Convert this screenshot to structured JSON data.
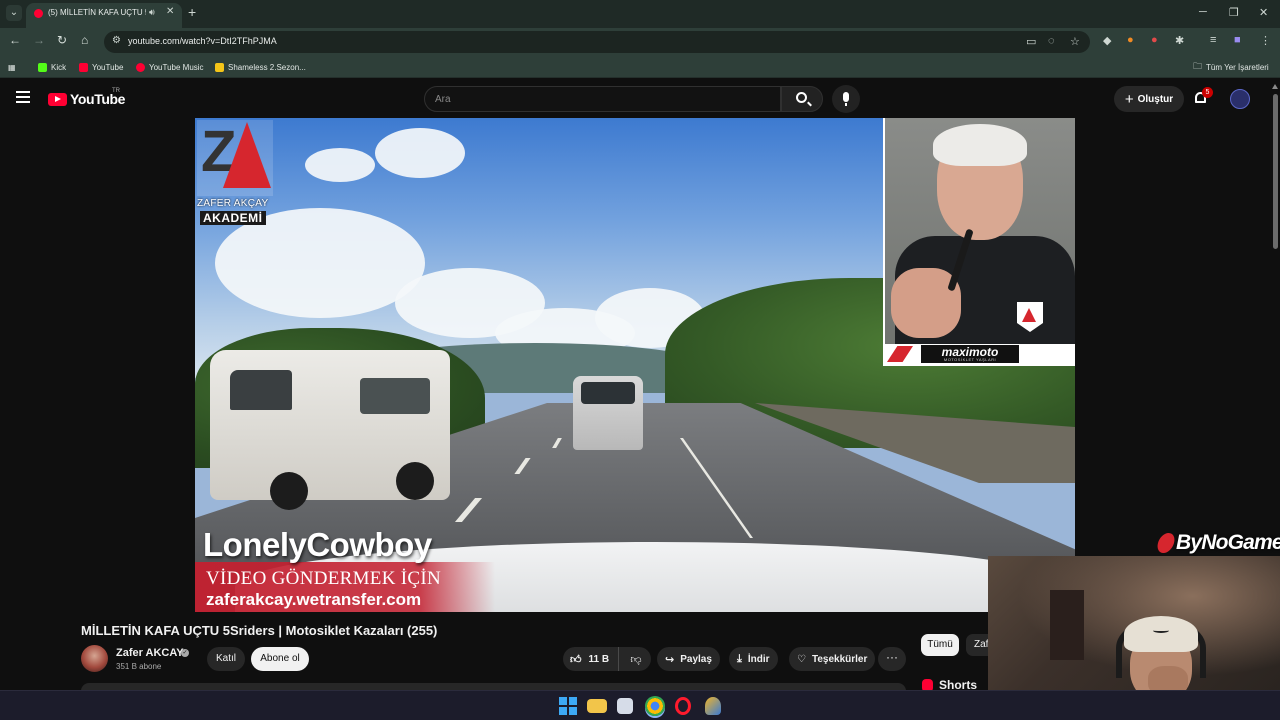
{
  "browser": {
    "tab_title": "(5) MİLLETİN KAFA UÇTU 5",
    "url": "youtube.com/watch?v=DtI2TFhPJMA",
    "bookmarks": [
      {
        "label": "Kick",
        "color": "#53fc18"
      },
      {
        "label": "YouTube",
        "color": "#ff0033"
      },
      {
        "label": "YouTube Music",
        "color": "#ff0033"
      },
      {
        "label": "Shameless 2.Sezon...",
        "color": "#f5c518"
      }
    ],
    "all_bookmarks_label": "Tüm Yer İşaretleri"
  },
  "youtube": {
    "logo_text": "YouTube",
    "country_code": "TR",
    "search_placeholder": "Ara",
    "create_label": "Oluştur",
    "notification_count": "5"
  },
  "video_overlay": {
    "logo_name": "ZAFER AKÇAY",
    "logo_academy": "AKADEMİ",
    "sender_name": "LonelyCowboy",
    "send_prompt": "VİDEO GÖNDERMEK İÇİN",
    "send_url": "zaferakcay.wetransfer.com",
    "sponsor_name": "maximoto",
    "sponsor_sub": "MOTOSİKLET YAŞLARI",
    "streamer_watermark": "ByNoGame"
  },
  "video": {
    "title": "MİLLETİN KAFA UÇTU 5Sriders | Motosiklet Kazaları (255)",
    "channel_name": "Zafer AKCAY",
    "subscribers": "351 B abone",
    "join_label": "Katıl",
    "subscribe_label": "Abone ol",
    "likes": "11 B",
    "share_label": "Paylaş",
    "download_label": "İndir",
    "thanks_label": "Teşekkürler",
    "more_label": "···"
  },
  "sidebar": {
    "chips": [
      "Tümü",
      "Zafer"
    ],
    "shorts_label": "Shorts"
  },
  "colors": {
    "youtube_red": "#ff0033",
    "brand_red": "#d6262e",
    "page_bg": "#0f0f0f"
  }
}
